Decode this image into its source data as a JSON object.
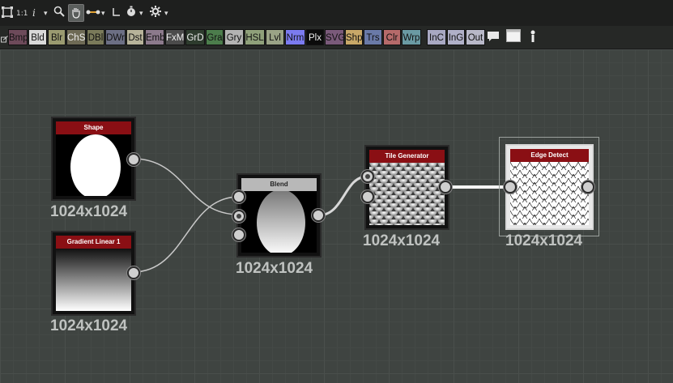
{
  "toolbar": {
    "zoom_label": "1:1",
    "info_label": "i",
    "dropdown_arrow": "▾"
  },
  "filters": [
    {
      "label": "Bmp",
      "bg": "#6d4a5a",
      "fg": "#111"
    },
    {
      "label": "Bld",
      "bg": "#d9d9d9",
      "fg": "#111"
    },
    {
      "label": "Blr",
      "bg": "#9a9a70",
      "fg": "#111"
    },
    {
      "label": "ChS",
      "bg": "#6e6a55",
      "fg": "#eee"
    },
    {
      "label": "DBl",
      "bg": "#7a7a5a",
      "fg": "#111"
    },
    {
      "label": "DWr",
      "bg": "#6c6f84",
      "fg": "#111"
    },
    {
      "label": "Dst",
      "bg": "#b7b39a",
      "fg": "#111"
    },
    {
      "label": "Emb",
      "bg": "#8c7a8c",
      "fg": "#111"
    },
    {
      "label": "FxM",
      "bg": "#4b4b4b",
      "fg": "#eee"
    },
    {
      "label": "GrD",
      "bg": "#2d3b2d",
      "fg": "#eee"
    },
    {
      "label": "Gra",
      "bg": "#4c7d4c",
      "fg": "#111"
    },
    {
      "label": "Gry",
      "bg": "#b3b3b3",
      "fg": "#111"
    },
    {
      "label": "HSL",
      "bg": "#8fa07a",
      "fg": "#111"
    },
    {
      "label": "Lvl",
      "bg": "#9aa386",
      "fg": "#111"
    },
    {
      "label": "Nrm",
      "bg": "#7b7bf0",
      "fg": "#111"
    },
    {
      "label": "Plx",
      "bg": "#0b0b0b",
      "fg": "#eee"
    },
    {
      "label": "SVG",
      "bg": "#7a5a7a",
      "fg": "#111"
    },
    {
      "label": "Shp",
      "bg": "#c8a868",
      "fg": "#111"
    },
    {
      "label": "Trs",
      "bg": "#6a7aa8",
      "fg": "#111"
    },
    {
      "label": "Clr",
      "bg": "#b66a6a",
      "fg": "#111"
    },
    {
      "label": "Wrp",
      "bg": "#6a9aa3",
      "fg": "#111"
    },
    {
      "label": "InC",
      "bg": "#a8a8c2",
      "fg": "#111"
    },
    {
      "label": "InG",
      "bg": "#b0b0c8",
      "fg": "#111"
    },
    {
      "label": "Out",
      "bg": "#b8b8c8",
      "fg": "#111"
    }
  ],
  "nodes": {
    "shape": {
      "title": "Shape",
      "resolution": "1024x1024"
    },
    "gradient": {
      "title": "Gradient Linear 1",
      "resolution": "1024x1024"
    },
    "blend": {
      "title": "Blend",
      "resolution": "1024x1024"
    },
    "tile": {
      "title": "Tile Generator",
      "resolution": "1024x1024"
    },
    "edge": {
      "title": "Edge Detect",
      "resolution": "1024x1024"
    }
  },
  "colors": {
    "node_title": "#8a0f14",
    "canvas": "#3f4441"
  }
}
